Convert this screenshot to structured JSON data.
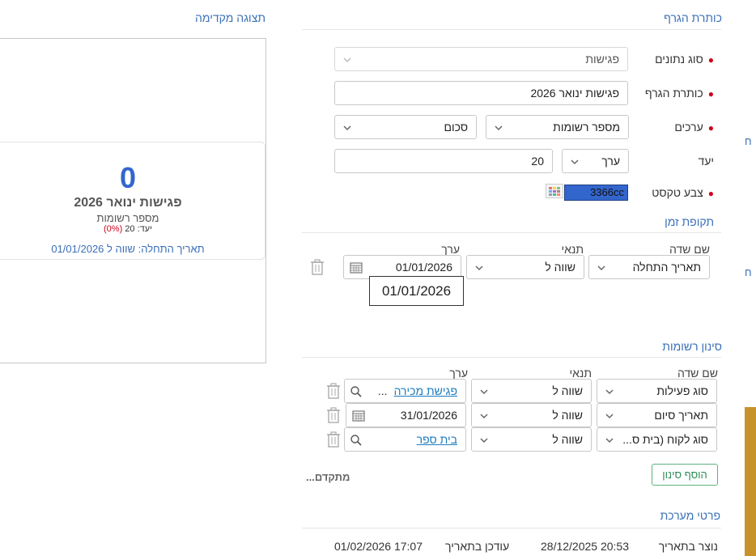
{
  "preview": {
    "title": "תצוגה מקדימה",
    "value": "0",
    "chart_title": "פגישות ינואר 2026",
    "subtitle": "מספר רשומות",
    "goal_label": "יעד: 20",
    "goal_pct": "(0%)",
    "filter_note": "תאריך התחלה: שווה ל 01/01/2026"
  },
  "chart_section": {
    "title": "כותרת הגרף",
    "data_type_label": "סוג נתונים",
    "data_type_value": "פגישות",
    "chart_title_label": "כותרת הגרף",
    "chart_title_value": "פגישות ינואר 2026",
    "values_label": "ערכים",
    "values_field": "מספר רשומות",
    "values_agg": "סכום",
    "goal_label": "יעד",
    "goal_type": "ערך",
    "goal_value": "20",
    "text_color_label": "צבע טקסט",
    "text_color_value": "3366cc",
    "text_color_hex": "#3366cc"
  },
  "time_period": {
    "title": "תקופת זמן",
    "col_field": "שם שדה",
    "col_condition": "תנאי",
    "col_value": "ערך",
    "row": {
      "field": "תאריך התחלה",
      "condition": "שווה ל",
      "value": "01/01/2026"
    },
    "tooltip": "01/01/2026"
  },
  "record_filter": {
    "title": "סינון רשומות",
    "col_field": "שם שדה",
    "col_condition": "תנאי",
    "col_value": "ערך",
    "rows": [
      {
        "field": "סוג פעילות",
        "condition": "שווה ל",
        "value": "פגישת מכירה",
        "more": "..."
      },
      {
        "field": "תאריך סיום",
        "condition": "שווה ל",
        "value": "31/01/2026"
      },
      {
        "field": "סוג לקוח (בית ס...",
        "condition": "שווה ל",
        "value": "בית ספר"
      }
    ],
    "add_filter": "הוסף סינון",
    "advanced": "מתקדם..."
  },
  "system_details": {
    "title": "פרטי מערכת",
    "created_label": "נוצר בתאריך",
    "created_value": "28/12/2025 20:53",
    "updated_label": "עודכן בתאריך",
    "updated_value": "01/02/2026 17:07"
  },
  "edge_letters": [
    "ח",
    "ח"
  ]
}
